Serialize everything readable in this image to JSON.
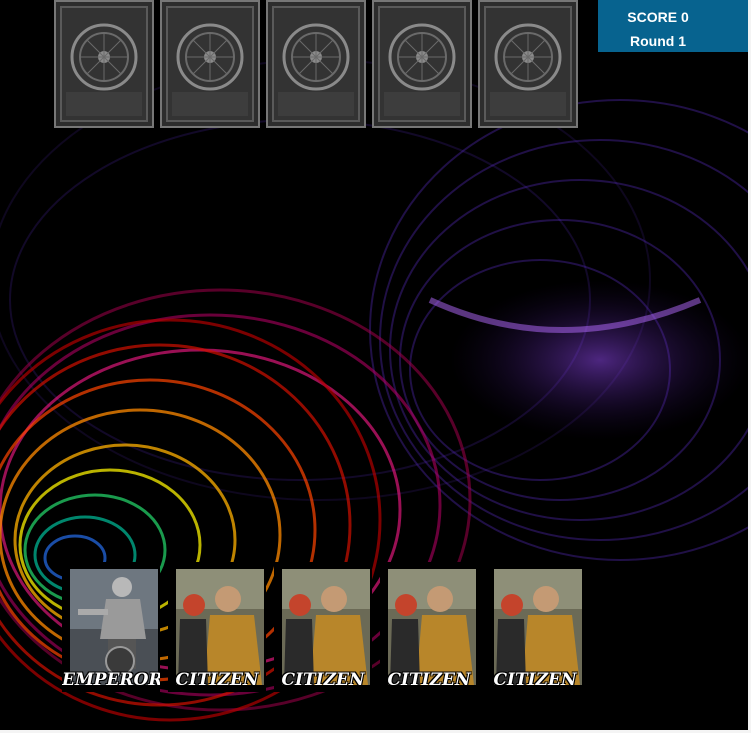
{
  "scoreboard": {
    "score_label": "SCORE 0",
    "round_label": "Round 1"
  },
  "opponent_hand": {
    "card_count": 5,
    "card_back": "face-down-card-back"
  },
  "player_hand": {
    "cards": [
      {
        "label": "EMPEROR",
        "icon": "emperor-card-art"
      },
      {
        "label": "CITIZEN",
        "icon": "citizen-card-art"
      },
      {
        "label": "CITIZEN",
        "icon": "citizen-card-art"
      },
      {
        "label": "CITIZEN",
        "icon": "citizen-card-art"
      },
      {
        "label": "CITIZEN",
        "icon": "citizen-card-art"
      }
    ]
  },
  "colors": {
    "scoreboard_bg": "#07638f",
    "background": "#000000"
  }
}
